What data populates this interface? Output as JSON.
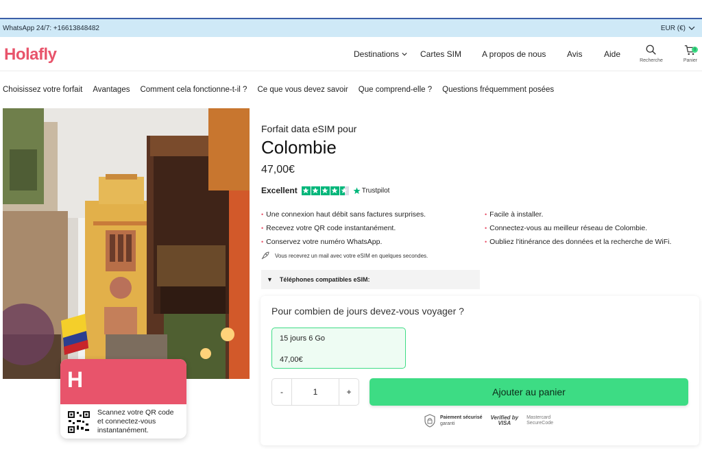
{
  "announcement": {
    "whatsapp": "WhatsApp 24/7: +16613848482",
    "currency": "EUR (€)"
  },
  "header": {
    "logo": "Holafly",
    "nav": {
      "destinations": "Destinations",
      "sim_cards": "Cartes SIM",
      "about": "A propos de nous",
      "reviews": "Avis",
      "help": "Aide"
    },
    "search_label": "Recherche",
    "cart_label": "Panier",
    "cart_count": "0"
  },
  "subnav": [
    "Choisissez votre forfait",
    "Avantages",
    "Comment cela fonctionne-t-il ?",
    "Ce que vous devez savoir",
    "Que comprend-elle ?",
    "Questions fréquemment posées"
  ],
  "promo_card": {
    "logo_letter": "H",
    "text": "Scannez votre QR code et connectez-vous instantanément."
  },
  "product": {
    "kicker": "Forfait data eSIM pour",
    "title": "Colombie",
    "price": "47,00€",
    "rating_label": "Excellent",
    "rating_stars": 4.5,
    "trustpilot": "Trustpilot",
    "features_left": [
      "Une connexion haut débit sans factures surprises.",
      "Recevez votre QR code instantanément.",
      "Conservez votre numéro WhatsApp."
    ],
    "features_right": [
      "Facile à installer.",
      "Connectez-vous au meilleur réseau de Colombie.",
      "Oubliez l'itinérance des données et la recherche de WiFi."
    ],
    "mail_note": "Vous recevrez un mail avec votre eSIM en quelques secondes.",
    "compat": "Téléphones compatibles eSIM:"
  },
  "purchase": {
    "question": "Pour combien de jours devez-vous voyager ?",
    "plan_name": "15 jours 6 Go",
    "plan_price": "47,00€",
    "qty_minus": "-",
    "qty_value": "1",
    "qty_plus": "+",
    "add_to_cart": "Ajouter au panier",
    "secure_title": "Paiement sécurisé",
    "secure_sub": "garanti",
    "visa_top": "Verified by",
    "visa_bottom": "VISA",
    "mc_top": "Mastercard",
    "mc_bottom": "SecureCode"
  },
  "colors": {
    "brand": "#e8546b",
    "accent_green": "#3ddc84",
    "trustpilot_green": "#00b67a",
    "announce_bg": "#cfe9f7"
  }
}
